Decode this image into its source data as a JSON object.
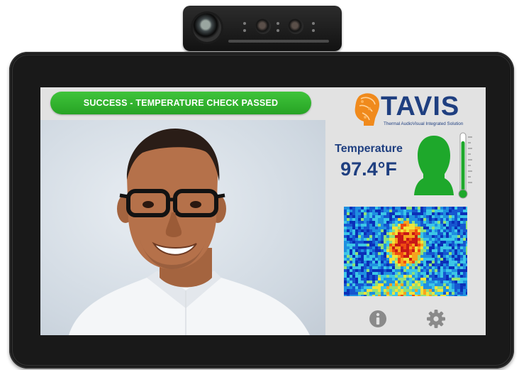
{
  "status": {
    "message": "SUCCESS - TEMPERATURE CHECK PASSED",
    "color": "#2fb32c"
  },
  "brand": {
    "name": "TAVIS",
    "tagline": "Thermal AudioVisual Integrated Solution",
    "color": "#1f3f80",
    "mark_color": "#f08a1c"
  },
  "reading": {
    "label": "Temperature",
    "value": "97.4°F",
    "status_color": "#1ea82b",
    "thermometer_level": 0.88
  },
  "panels": {
    "camera_feed": "live-camera-feed",
    "thermal_image": "thermal-heatmap"
  },
  "controls": {
    "info_icon": "info-icon",
    "settings_icon": "gear-icon"
  }
}
